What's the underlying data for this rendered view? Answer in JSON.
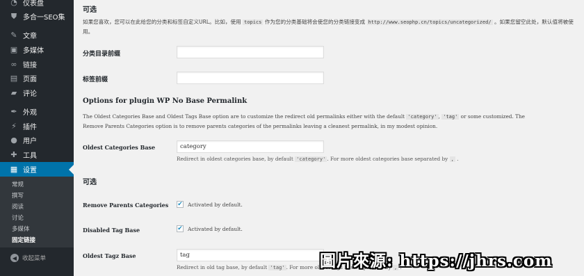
{
  "sidebar": {
    "items": [
      {
        "label": "仪表盘",
        "icon": "dashboard-icon",
        "glyph": "◔"
      },
      {
        "label": "多合一SEO集",
        "icon": "shield-icon",
        "glyph": "⛊"
      },
      {
        "label": "文章",
        "icon": "pin-icon",
        "glyph": "✎"
      },
      {
        "label": "多媒体",
        "icon": "media-icon",
        "glyph": "▣"
      },
      {
        "label": "链接",
        "icon": "link-icon",
        "glyph": "∞"
      },
      {
        "label": "页面",
        "icon": "page-icon",
        "glyph": "▤"
      },
      {
        "label": "评论",
        "icon": "comment-icon",
        "glyph": "▰"
      },
      {
        "label": "外观",
        "icon": "brush-icon",
        "glyph": "✒"
      },
      {
        "label": "插件",
        "icon": "plugin-icon",
        "glyph": "⚡"
      },
      {
        "label": "用户",
        "icon": "user-icon",
        "glyph": "●"
      },
      {
        "label": "工具",
        "icon": "wrench-icon",
        "glyph": "✚"
      },
      {
        "label": "设置",
        "icon": "settings-icon",
        "glyph": "▦",
        "current": true
      }
    ],
    "submenu": [
      "常规",
      "撰写",
      "阅读",
      "讨论",
      "多媒体",
      "固定链接"
    ],
    "submenu_active": "固定链接",
    "collapse_label": "收起菜单",
    "accent": "#0073aa",
    "bg": "#23282d"
  },
  "main": {
    "optional_title": "可选",
    "optional_desc_pre": "如果您喜欢，您可以在此给您的分类和标签自定义URL。比如，使用",
    "optional_desc_code1": "topics",
    "optional_desc_mid": "作为您的分类基础将会使您的分类链接变成",
    "optional_desc_code2": "http://www.seophp.cn/topics/uncategorized/",
    "optional_desc_post": "。如果您留空此处，默认值将被使用。",
    "category_base_label": "分类目录前缀",
    "category_base_value": "",
    "tag_base_label": "标签前缀",
    "tag_base_value": "",
    "plugin_title": "Options for plugin WP No Base Permalink",
    "plugin_desc_1": "The Oldest Categories Base and Oldest Tags Base option are to customize the redirect old permalinks either with the default",
    "plugin_desc_code1": "'category'",
    "plugin_desc_sep": ",",
    "plugin_desc_code2": "'tag'",
    "plugin_desc_2": "or some customized. The",
    "plugin_desc_3": "Remove Parents Categories option is to remove parents categories of the permalinks leaving a cleanest permalink, in my modest opinion.",
    "oldest_cat_label": "Oldest Categories Base",
    "oldest_cat_value": "category",
    "oldest_cat_note_pre": "Redirect in oldest categories base, by default",
    "oldest_cat_note_code": "'category'",
    "oldest_cat_note_post": ". For more oldest categories base separated by",
    "oldest_cat_note_code2": ",",
    "oldest_cat_note_end": ".",
    "optional_title_2": "可选",
    "remove_parents_label": "Remove Parents Categories",
    "remove_parents_checked": true,
    "remove_parents_text": "Activated by default.",
    "disabled_tag_label": "Disabled Tag Base",
    "disabled_tag_checked": true,
    "disabled_tag_text": "Activated by default.",
    "oldest_tag_label": "Oldest Tagz Base",
    "oldest_tag_value": "tag",
    "oldest_tag_note_pre": "Redirect in old tag base, by default",
    "oldest_tag_note_code": "'tag'",
    "oldest_tag_note_post": ". For more oldest tags base separated by",
    "oldest_tag_note_code2": ",",
    "oldest_tag_note_end": "."
  },
  "watermark": "圖片來源: https://jhrs.com"
}
